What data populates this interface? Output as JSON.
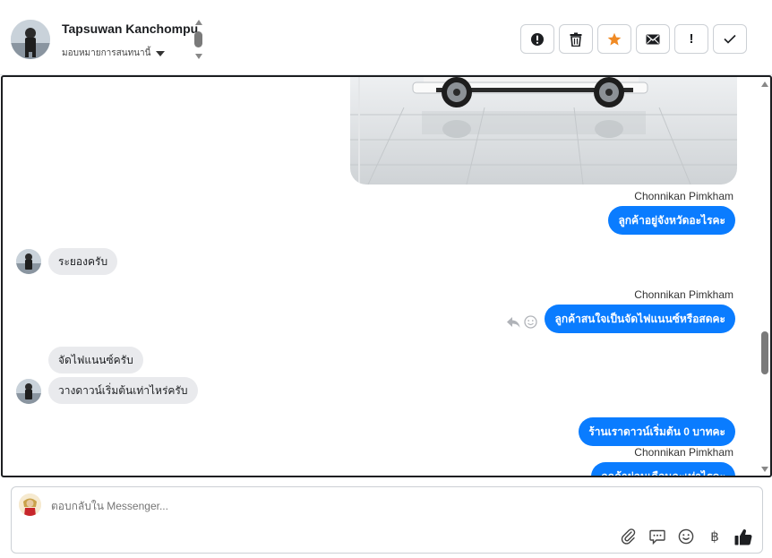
{
  "header": {
    "contact_name": "Tapsuwan Kanchompu",
    "assign_label": "มอบหมายการสนทนานี้",
    "actions": [
      {
        "name": "alert-icon",
        "label": ""
      },
      {
        "name": "trash-icon",
        "label": ""
      },
      {
        "name": "star-icon",
        "label": ""
      },
      {
        "name": "mail-icon",
        "label": ""
      },
      {
        "name": "exclamation-icon",
        "label": "!"
      },
      {
        "name": "check-icon",
        "label": ""
      }
    ],
    "star_color": "#f08a24"
  },
  "messages": [
    {
      "kind": "image",
      "from": "page",
      "alt": "car-photo"
    },
    {
      "kind": "sender",
      "text": "Chonnikan Pimkham"
    },
    {
      "kind": "out",
      "text": "ลูกค้าอยู่จังหวัดอะไรคะ"
    },
    {
      "kind": "in",
      "text": "ระยองครับ"
    },
    {
      "kind": "sender",
      "text": "Chonnikan Pimkham"
    },
    {
      "kind": "out",
      "text": "ลูกค้าสนใจเป็นจัดไฟแนนซ์หรือสดคะ"
    },
    {
      "kind": "in",
      "text": "จัดไฟแนนซ์ครับ"
    },
    {
      "kind": "in",
      "text": "วางดาวน์เริ่มต้นเท่าไหร่ครับ"
    },
    {
      "kind": "out",
      "text": "ร้านเราดาวน์เริ่มต้น 0 บาทคะ"
    },
    {
      "kind": "sender",
      "text": "Chonnikan Pimkham"
    },
    {
      "kind": "out",
      "text": "ลูกค้าผ่อนเดือนละเท่าไรคะ"
    }
  ],
  "composer": {
    "placeholder": "ตอบกลับใน Messenger...",
    "tools": [
      "attach-icon",
      "comment-icon",
      "emoji-icon",
      "baht-icon",
      "like-icon"
    ],
    "baht_symbol": "฿"
  },
  "colors": {
    "accent": "#0a7cff",
    "incoming_bubble": "#e9eaed"
  }
}
